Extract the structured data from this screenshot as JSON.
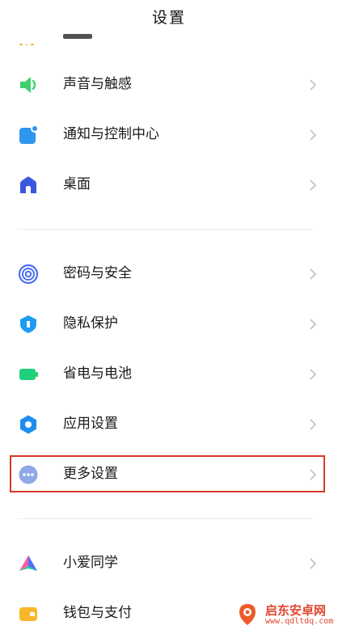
{
  "header": {
    "title": "设置"
  },
  "items": [
    {
      "label": "声音与触感",
      "icon": "speaker-icon",
      "color": "#3ecf6e"
    },
    {
      "label": "通知与控制中心",
      "icon": "notification-icon",
      "color": "#2f96f0"
    },
    {
      "label": "桌面",
      "icon": "home-icon",
      "color": "#3b57e0"
    },
    {
      "label": "密码与安全",
      "icon": "fingerprint-icon",
      "color": "#4b6ef2"
    },
    {
      "label": "隐私保护",
      "icon": "privacy-shield-icon",
      "color": "#1e9bf2"
    },
    {
      "label": "省电与电池",
      "icon": "battery-icon",
      "color": "#1fd07a"
    },
    {
      "label": "应用设置",
      "icon": "gear-icon",
      "color": "#1f8df0"
    },
    {
      "label": "更多设置",
      "icon": "more-dots-icon",
      "color": "#8fa8e8"
    },
    {
      "label": "小爱同学",
      "icon": "xiaoai-icon",
      "color": "#ff5aa0"
    },
    {
      "label": "钱包与支付",
      "icon": "wallet-icon",
      "color": "#f6b82a"
    }
  ],
  "watermark": {
    "name": "启东安卓网",
    "url": "www.qdltdq.com"
  }
}
